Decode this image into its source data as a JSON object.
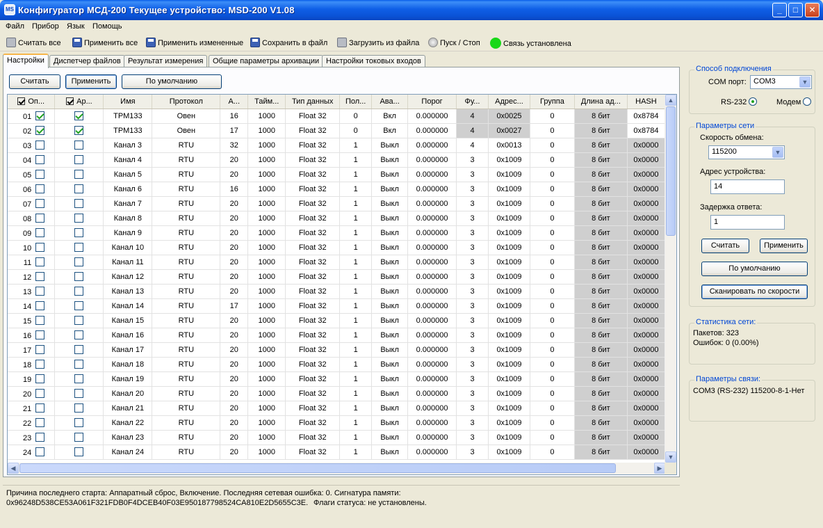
{
  "window": {
    "title": "Конфигуратор МСД-200   Текущее устройство: MSD-200 V1.08",
    "icon_text": "MS",
    "min_glyph": "_",
    "max_glyph": "□",
    "close_glyph": "✕"
  },
  "menu": [
    "Файл",
    "Прибор",
    "Язык",
    "Помощь"
  ],
  "toolbar": {
    "read_all": "Считать все",
    "apply_all": "Применить все",
    "apply_changed": "Применить измененные",
    "save_file": "Сохранить в файл",
    "load_file": "Загрузить из файла",
    "start_stop": "Пуск / Стоп",
    "connection_status": "Связь установлена",
    "status_color": "#18d818"
  },
  "tabs": [
    "Настройки",
    "Диспетчер файлов",
    "Результат измерения",
    "Общие параметры архивации",
    "Настройки токовых входов"
  ],
  "panel_buttons": {
    "read": "Считать",
    "apply": "Применить",
    "default": "По умолчанию"
  },
  "table": {
    "columns": [
      "Оп...",
      "Ар...",
      "Имя",
      "Протокол",
      "А...",
      "Тайм...",
      "Тип данных",
      "Пол...",
      "Ава...",
      "Порог",
      "Фу...",
      "Адрес...",
      "Группа",
      "Длина ад...",
      "HASH"
    ],
    "header_checks": [
      true,
      true
    ],
    "rows": [
      {
        "num": "01",
        "op": true,
        "ar": true,
        "name": "ТРМ133",
        "proto": "Овен",
        "a": "16",
        "timeout": "1000",
        "dtype": "Float 32",
        "pol": "0",
        "alarm": "Вкл",
        "threshold": "0.000000",
        "func": "4",
        "addr": "0x0025",
        "group": "0",
        "alen": "8 бит",
        "hash": "0x8784"
      },
      {
        "num": "02",
        "op": true,
        "ar": true,
        "name": "ТРМ133",
        "proto": "Овен",
        "a": "17",
        "timeout": "1000",
        "dtype": "Float 32",
        "pol": "0",
        "alarm": "Вкл",
        "threshold": "0.000000",
        "func": "4",
        "addr": "0x0027",
        "group": "0",
        "alen": "8 бит",
        "hash": "0x8784"
      },
      {
        "num": "03",
        "op": false,
        "ar": false,
        "name": "Канал 3",
        "proto": "RTU",
        "a": "32",
        "timeout": "1000",
        "dtype": "Float 32",
        "pol": "1",
        "alarm": "Выкл",
        "threshold": "0.000000",
        "func": "4",
        "addr": "0x0013",
        "group": "0",
        "alen": "8 бит",
        "hash": "0x0000"
      },
      {
        "num": "04",
        "op": false,
        "ar": false,
        "name": "Канал 4",
        "proto": "RTU",
        "a": "20",
        "timeout": "1000",
        "dtype": "Float 32",
        "pol": "1",
        "alarm": "Выкл",
        "threshold": "0.000000",
        "func": "3",
        "addr": "0x1009",
        "group": "0",
        "alen": "8 бит",
        "hash": "0x0000"
      },
      {
        "num": "05",
        "op": false,
        "ar": false,
        "name": "Канал 5",
        "proto": "RTU",
        "a": "20",
        "timeout": "1000",
        "dtype": "Float 32",
        "pol": "1",
        "alarm": "Выкл",
        "threshold": "0.000000",
        "func": "3",
        "addr": "0x1009",
        "group": "0",
        "alen": "8 бит",
        "hash": "0x0000"
      },
      {
        "num": "06",
        "op": false,
        "ar": false,
        "name": "Канал 6",
        "proto": "RTU",
        "a": "16",
        "timeout": "1000",
        "dtype": "Float 32",
        "pol": "1",
        "alarm": "Выкл",
        "threshold": "0.000000",
        "func": "3",
        "addr": "0x1009",
        "group": "0",
        "alen": "8 бит",
        "hash": "0x0000"
      },
      {
        "num": "07",
        "op": false,
        "ar": false,
        "name": "Канал 7",
        "proto": "RTU",
        "a": "20",
        "timeout": "1000",
        "dtype": "Float 32",
        "pol": "1",
        "alarm": "Выкл",
        "threshold": "0.000000",
        "func": "3",
        "addr": "0x1009",
        "group": "0",
        "alen": "8 бит",
        "hash": "0x0000"
      },
      {
        "num": "08",
        "op": false,
        "ar": false,
        "name": "Канал 8",
        "proto": "RTU",
        "a": "20",
        "timeout": "1000",
        "dtype": "Float 32",
        "pol": "1",
        "alarm": "Выкл",
        "threshold": "0.000000",
        "func": "3",
        "addr": "0x1009",
        "group": "0",
        "alen": "8 бит",
        "hash": "0x0000"
      },
      {
        "num": "09",
        "op": false,
        "ar": false,
        "name": "Канал 9",
        "proto": "RTU",
        "a": "20",
        "timeout": "1000",
        "dtype": "Float 32",
        "pol": "1",
        "alarm": "Выкл",
        "threshold": "0.000000",
        "func": "3",
        "addr": "0x1009",
        "group": "0",
        "alen": "8 бит",
        "hash": "0x0000"
      },
      {
        "num": "10",
        "op": false,
        "ar": false,
        "name": "Канал 10",
        "proto": "RTU",
        "a": "20",
        "timeout": "1000",
        "dtype": "Float 32",
        "pol": "1",
        "alarm": "Выкл",
        "threshold": "0.000000",
        "func": "3",
        "addr": "0x1009",
        "group": "0",
        "alen": "8 бит",
        "hash": "0x0000"
      },
      {
        "num": "11",
        "op": false,
        "ar": false,
        "name": "Канал 11",
        "proto": "RTU",
        "a": "20",
        "timeout": "1000",
        "dtype": "Float 32",
        "pol": "1",
        "alarm": "Выкл",
        "threshold": "0.000000",
        "func": "3",
        "addr": "0x1009",
        "group": "0",
        "alen": "8 бит",
        "hash": "0x0000"
      },
      {
        "num": "12",
        "op": false,
        "ar": false,
        "name": "Канал 12",
        "proto": "RTU",
        "a": "20",
        "timeout": "1000",
        "dtype": "Float 32",
        "pol": "1",
        "alarm": "Выкл",
        "threshold": "0.000000",
        "func": "3",
        "addr": "0x1009",
        "group": "0",
        "alen": "8 бит",
        "hash": "0x0000"
      },
      {
        "num": "13",
        "op": false,
        "ar": false,
        "name": "Канал 13",
        "proto": "RTU",
        "a": "20",
        "timeout": "1000",
        "dtype": "Float 32",
        "pol": "1",
        "alarm": "Выкл",
        "threshold": "0.000000",
        "func": "3",
        "addr": "0x1009",
        "group": "0",
        "alen": "8 бит",
        "hash": "0x0000"
      },
      {
        "num": "14",
        "op": false,
        "ar": false,
        "name": "Канал 14",
        "proto": "RTU",
        "a": "17",
        "timeout": "1000",
        "dtype": "Float 32",
        "pol": "1",
        "alarm": "Выкл",
        "threshold": "0.000000",
        "func": "3",
        "addr": "0x1009",
        "group": "0",
        "alen": "8 бит",
        "hash": "0x0000"
      },
      {
        "num": "15",
        "op": false,
        "ar": false,
        "name": "Канал 15",
        "proto": "RTU",
        "a": "20",
        "timeout": "1000",
        "dtype": "Float 32",
        "pol": "1",
        "alarm": "Выкл",
        "threshold": "0.000000",
        "func": "3",
        "addr": "0x1009",
        "group": "0",
        "alen": "8 бит",
        "hash": "0x0000"
      },
      {
        "num": "16",
        "op": false,
        "ar": false,
        "name": "Канал 16",
        "proto": "RTU",
        "a": "20",
        "timeout": "1000",
        "dtype": "Float 32",
        "pol": "1",
        "alarm": "Выкл",
        "threshold": "0.000000",
        "func": "3",
        "addr": "0x1009",
        "group": "0",
        "alen": "8 бит",
        "hash": "0x0000"
      },
      {
        "num": "17",
        "op": false,
        "ar": false,
        "name": "Канал 17",
        "proto": "RTU",
        "a": "20",
        "timeout": "1000",
        "dtype": "Float 32",
        "pol": "1",
        "alarm": "Выкл",
        "threshold": "0.000000",
        "func": "3",
        "addr": "0x1009",
        "group": "0",
        "alen": "8 бит",
        "hash": "0x0000"
      },
      {
        "num": "18",
        "op": false,
        "ar": false,
        "name": "Канал 18",
        "proto": "RTU",
        "a": "20",
        "timeout": "1000",
        "dtype": "Float 32",
        "pol": "1",
        "alarm": "Выкл",
        "threshold": "0.000000",
        "func": "3",
        "addr": "0x1009",
        "group": "0",
        "alen": "8 бит",
        "hash": "0x0000"
      },
      {
        "num": "19",
        "op": false,
        "ar": false,
        "name": "Канал 19",
        "proto": "RTU",
        "a": "20",
        "timeout": "1000",
        "dtype": "Float 32",
        "pol": "1",
        "alarm": "Выкл",
        "threshold": "0.000000",
        "func": "3",
        "addr": "0x1009",
        "group": "0",
        "alen": "8 бит",
        "hash": "0x0000"
      },
      {
        "num": "20",
        "op": false,
        "ar": false,
        "name": "Канал 20",
        "proto": "RTU",
        "a": "20",
        "timeout": "1000",
        "dtype": "Float 32",
        "pol": "1",
        "alarm": "Выкл",
        "threshold": "0.000000",
        "func": "3",
        "addr": "0x1009",
        "group": "0",
        "alen": "8 бит",
        "hash": "0x0000"
      },
      {
        "num": "21",
        "op": false,
        "ar": false,
        "name": "Канал 21",
        "proto": "RTU",
        "a": "20",
        "timeout": "1000",
        "dtype": "Float 32",
        "pol": "1",
        "alarm": "Выкл",
        "threshold": "0.000000",
        "func": "3",
        "addr": "0x1009",
        "group": "0",
        "alen": "8 бит",
        "hash": "0x0000"
      },
      {
        "num": "22",
        "op": false,
        "ar": false,
        "name": "Канал 22",
        "proto": "RTU",
        "a": "20",
        "timeout": "1000",
        "dtype": "Float 32",
        "pol": "1",
        "alarm": "Выкл",
        "threshold": "0.000000",
        "func": "3",
        "addr": "0x1009",
        "group": "0",
        "alen": "8 бит",
        "hash": "0x0000"
      },
      {
        "num": "23",
        "op": false,
        "ar": false,
        "name": "Канал 23",
        "proto": "RTU",
        "a": "20",
        "timeout": "1000",
        "dtype": "Float 32",
        "pol": "1",
        "alarm": "Выкл",
        "threshold": "0.000000",
        "func": "3",
        "addr": "0x1009",
        "group": "0",
        "alen": "8 бит",
        "hash": "0x0000"
      },
      {
        "num": "24",
        "op": false,
        "ar": false,
        "name": "Канал 24",
        "proto": "RTU",
        "a": "20",
        "timeout": "1000",
        "dtype": "Float 32",
        "pol": "1",
        "alarm": "Выкл",
        "threshold": "0.000000",
        "func": "3",
        "addr": "0x1009",
        "group": "0",
        "alen": "8 бит",
        "hash": "0x0000"
      }
    ]
  },
  "scroll": {
    "up": "▲",
    "down": "▼",
    "left": "◀",
    "right": "▶"
  },
  "connection": {
    "legend": "Способ подключения",
    "com_label": "COM порт:",
    "com_value": "COM3",
    "rs232_label": "RS-232",
    "modem_label": "Модем",
    "rs232_selected": true,
    "combo_arrow": "▼"
  },
  "network": {
    "legend": "Параметры сети",
    "speed_label": "Скорость обмена:",
    "speed_value": "115200",
    "address_label": "Адрес устройства:",
    "address_value": "14",
    "delay_label": "Задержка ответа:",
    "delay_value": "1",
    "read_button": "Считать",
    "apply_button": "Применить",
    "default_button": "По умолчанию",
    "scan_button": "Сканировать по скорости"
  },
  "stats": {
    "legend": "Статистика сети:",
    "packets": "Пакетов: 323",
    "errors": "Ошибок: 0 (0.00%)"
  },
  "link": {
    "legend": "Параметры связи:",
    "value": "COM3 (RS-232)  115200-8-1-Нет"
  },
  "status": {
    "line1": "Причина последнего старта: Аппаратный сброс, Включение.  Последняя сетевая ошибка: 0. Сигнатура памяти:",
    "line2_signature": "0x96248D538CE53A061F321FDB0F4DCEB40F03E950187798524CA810E2D5655C3E.",
    "line2_flags": "Флаги статуса: не установлены."
  }
}
